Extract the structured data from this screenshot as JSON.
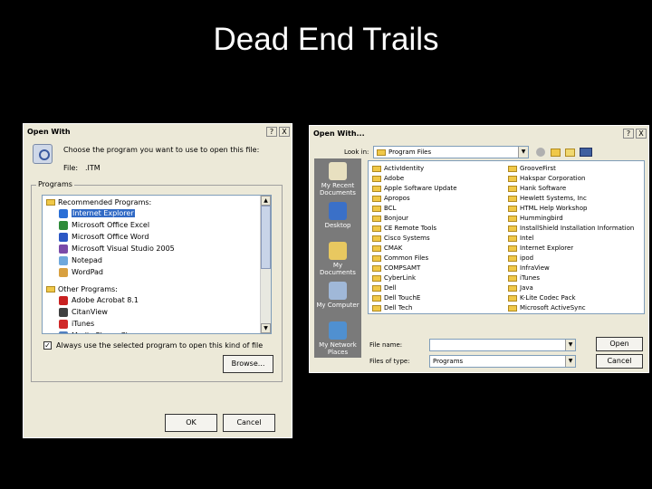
{
  "slide": {
    "title": "Dead End Trails"
  },
  "dialog1": {
    "title": "Open With",
    "help": "?",
    "close": "X",
    "prompt": "Choose the program you want to use to open this file:",
    "file_label": "File:",
    "file_value": ".ITM",
    "group_label": "Programs",
    "recommended_label": "Recommended Programs:",
    "recommended": [
      {
        "label": "Internet Explorer",
        "color": "#2a6fd6",
        "selected": true
      },
      {
        "label": "Microsoft Office Excel",
        "color": "#2e8b3a"
      },
      {
        "label": "Microsoft Office Word",
        "color": "#2b57c4"
      },
      {
        "label": "Microsoft Visual Studio 2005",
        "color": "#7a4aa8"
      },
      {
        "label": "Notepad",
        "color": "#6fa8dc"
      },
      {
        "label": "WordPad",
        "color": "#d8a040"
      }
    ],
    "other_label": "Other Programs:",
    "other": [
      {
        "label": "Adobe Acrobat 8.1",
        "color": "#c82020"
      },
      {
        "label": "CitanView",
        "color": "#404040"
      },
      {
        "label": "iTunes",
        "color": "#d02828"
      },
      {
        "label": "Media Player Cl...",
        "color": "#5080c0"
      }
    ],
    "always_label": "Always use the selected program to open this kind of file",
    "always_checked": "✓",
    "browse": "Browse...",
    "ok": "OK",
    "cancel": "Cancel"
  },
  "dialog2": {
    "title": "Open With...",
    "help": "?",
    "close": "X",
    "look_in_label": "Look in:",
    "look_in_value": "Program Files",
    "places": [
      {
        "label": "My Recent Documents",
        "color": "#e8e0c0"
      },
      {
        "label": "Desktop",
        "color": "#3a70c8"
      },
      {
        "label": "My Documents",
        "color": "#e8c860"
      },
      {
        "label": "My Computer",
        "color": "#a0b8d8"
      },
      {
        "label": "My Network Places",
        "color": "#5090d0"
      }
    ],
    "files_col1": [
      "ActivIdentity",
      "Adobe",
      "Apple Software Update",
      "Apropos",
      "BCL",
      "Bonjour",
      "CE Remote Tools",
      "Cisco Systems",
      "CMAK",
      "Common Files",
      "COMPSAMT",
      "CyberLink",
      "Dell",
      "Dell TouchE",
      "Dell Tech"
    ],
    "files_col2": [
      "GrooveFirst",
      "Hakspar Corporation",
      "Hank Software",
      "Hewlett Systems, Inc",
      "HTML Help Workshop",
      "Hummingbird",
      "InstallShield Installation Information",
      "Intel",
      "Internet Explorer",
      "ipod",
      "InfraView",
      "iTunes",
      "Java",
      "K-Lite Codec Pack",
      "Microsoft ActiveSync"
    ],
    "filename_label": "File name:",
    "filename_value": "",
    "filetype_label": "Files of type:",
    "filetype_value": "Programs",
    "open": "Open",
    "cancel": "Cancel"
  }
}
